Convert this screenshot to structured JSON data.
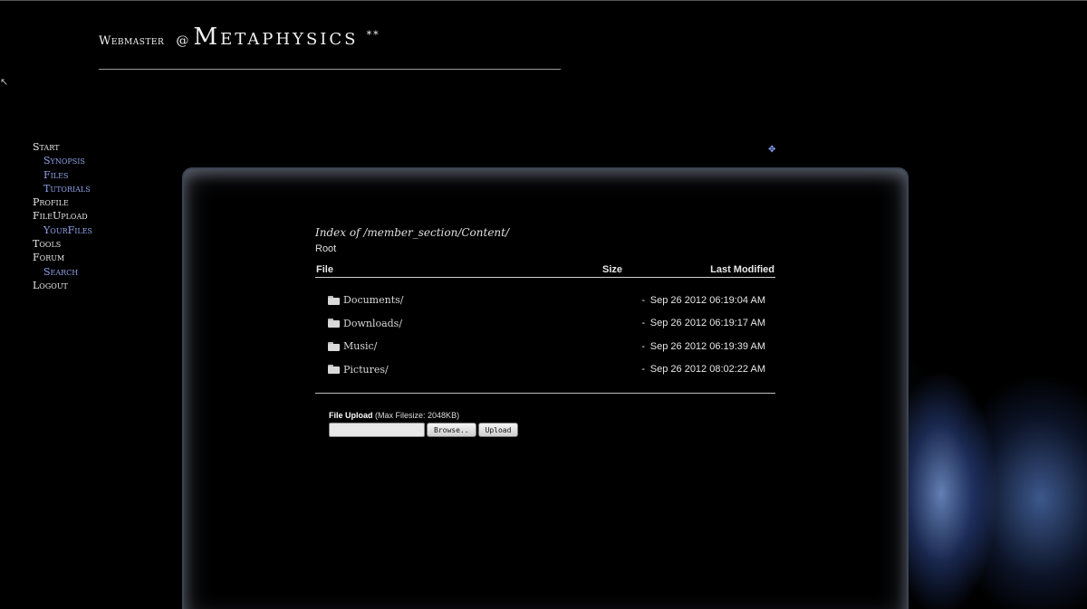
{
  "header": {
    "prefix": "Webmaster",
    "at": "@",
    "brand": "Metaphysics",
    "stars": "**"
  },
  "nav": {
    "items": [
      {
        "label": "Start",
        "sub": false
      },
      {
        "label": "Synopsis",
        "sub": true
      },
      {
        "label": "Files",
        "sub": true
      },
      {
        "label": "Tutorials",
        "sub": true
      },
      {
        "label": "Profile",
        "sub": false
      },
      {
        "label": "FileUpload",
        "sub": false
      },
      {
        "label": "YourFiles",
        "sub": true
      },
      {
        "label": "Tools",
        "sub": false
      },
      {
        "label": "Forum",
        "sub": false
      },
      {
        "label": "Search",
        "sub": true
      },
      {
        "label": "Logout",
        "sub": false
      }
    ]
  },
  "listing": {
    "title": "Index of /member_section/Content/",
    "root": "Root",
    "columns": {
      "file": "File",
      "size": "Size",
      "modified": "Last Modified"
    },
    "rows": [
      {
        "name": "Documents/",
        "size": "-",
        "modified": "Sep 26 2012 06:19:04 AM"
      },
      {
        "name": "Downloads/",
        "size": "-",
        "modified": "Sep 26 2012 06:19:17 AM"
      },
      {
        "name": "Music/",
        "size": "-",
        "modified": "Sep 26 2012 06:19:39 AM"
      },
      {
        "name": "Pictures/",
        "size": "-",
        "modified": "Sep 26 2012 08:02:22 AM"
      }
    ]
  },
  "upload": {
    "label": "File Upload",
    "hint": "(Max Filesize: 2048KB)",
    "browse": "Browse..",
    "submit": "Upload"
  },
  "colors": {
    "accent_link": "#8fa3e8",
    "background": "#000000",
    "panel_glow": "#3b4455"
  }
}
